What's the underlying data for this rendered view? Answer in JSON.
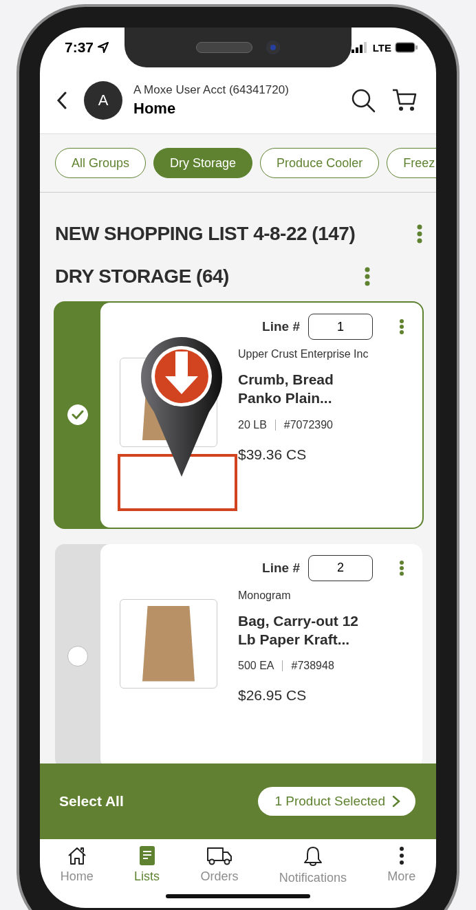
{
  "status_bar": {
    "time": "7:37",
    "network": "LTE"
  },
  "header": {
    "avatar_letter": "A",
    "account": "A Moxe User Acct (64341720)",
    "title": "Home"
  },
  "groups": [
    {
      "label": "All Groups",
      "selected": false
    },
    {
      "label": "Dry Storage",
      "selected": true
    },
    {
      "label": "Produce Cooler",
      "selected": false
    },
    {
      "label": "Freez",
      "selected": false
    }
  ],
  "list_title": "NEW SHOPPING LIST 4-8-22 (147)",
  "section_title": "DRY STORAGE (64)",
  "products": [
    {
      "selected": true,
      "highlighted": true,
      "line_label": "Line #",
      "line": "1",
      "vendor": "Upper Crust Enterprise Inc",
      "name": "Crumb, Bread Panko Plain...",
      "size": "20 LB",
      "item_no": "#7072390",
      "price": "$39.36 CS"
    },
    {
      "selected": false,
      "highlighted": false,
      "line_label": "Line #",
      "line": "2",
      "vendor": "Monogram",
      "name": "Bag, Carry-out 12 Lb Paper Kraft...",
      "size": "500 EA",
      "item_no": "#738948",
      "price": "$26.95 CS"
    }
  ],
  "action_bar": {
    "select_all": "Select All",
    "selected_button": "1 Product Selected"
  },
  "nav": [
    {
      "label": "Home",
      "selected": false
    },
    {
      "label": "Lists",
      "selected": true
    },
    {
      "label": "Orders",
      "selected": false
    },
    {
      "label": "Notifications",
      "selected": false
    },
    {
      "label": "More",
      "selected": false
    }
  ]
}
